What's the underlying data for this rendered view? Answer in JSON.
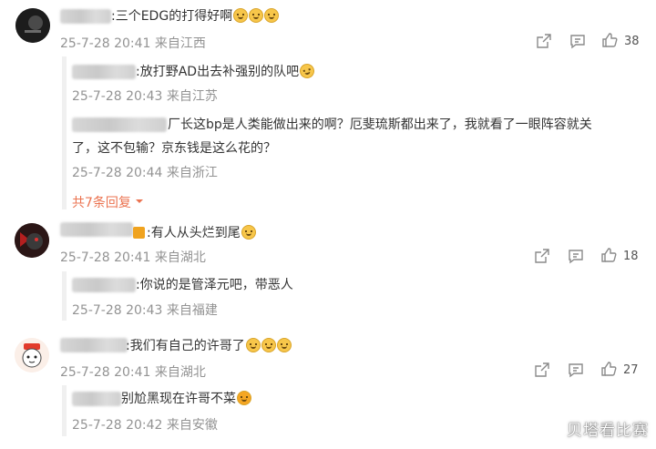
{
  "comments": [
    {
      "text": ":三个EDG的打得好啊",
      "meta": "25-7-28 20:41 来自江西",
      "likes": "38",
      "replies": [
        {
          "text": ":放打野AD出去补强别的队吧",
          "meta": "25-7-28 20:43 来自江苏"
        },
        {
          "text_line1": "厂长这bp是人类能做出来的啊？厄斐琉斯都出来了，我就看了一眼阵容就关",
          "text_line2": "了，这不包输？京东钱是这么花的？",
          "meta": "25-7-28 20:44 来自浙江"
        }
      ],
      "more_label": "共7条回复"
    },
    {
      "text": ":有人从头烂到尾",
      "meta": "25-7-28 20:41 来自湖北",
      "likes": "18",
      "replies": [
        {
          "text": ":你说的是管泽元吧，带恶人",
          "meta": "25-7-28 20:43 来自福建"
        }
      ]
    },
    {
      "text": ":我们有自己的许哥了",
      "meta": "25-7-28 20:41 来自湖北",
      "likes": "27",
      "replies": [
        {
          "text": "别尬黑现在许哥不菜",
          "meta": "25-7-28 20:42 来自安徽"
        }
      ]
    }
  ],
  "icons": [
    "share-icon",
    "comment-icon",
    "like-icon",
    "chevron-down-icon"
  ],
  "watermark": "贝塔看比赛",
  "colors": {
    "meta": "#939393",
    "accent": "#eb7350"
  }
}
